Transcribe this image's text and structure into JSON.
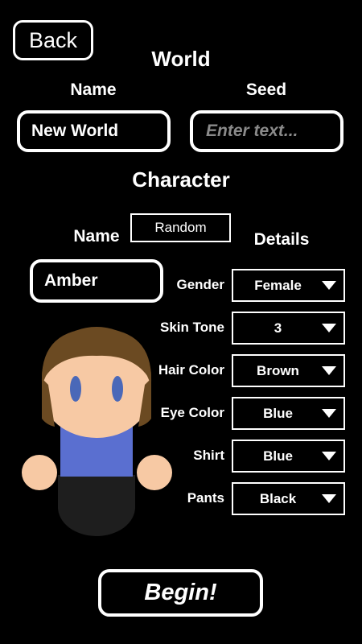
{
  "back_label": "Back",
  "world": {
    "heading": "World",
    "name_label": "Name",
    "seed_label": "Seed",
    "name_value": "New World",
    "seed_placeholder": "Enter text..."
  },
  "character": {
    "heading": "Character",
    "name_label": "Name",
    "random_label": "Random",
    "name_value": "Amber",
    "details_label": "Details",
    "details": [
      {
        "label": "Gender",
        "value": "Female"
      },
      {
        "label": "Skin Tone",
        "value": "3"
      },
      {
        "label": "Hair Color",
        "value": "Brown"
      },
      {
        "label": "Eye Color",
        "value": "Blue"
      },
      {
        "label": "Shirt",
        "value": "Blue"
      },
      {
        "label": "Pants",
        "value": "Black"
      }
    ],
    "avatar_colors": {
      "skin": "#f7c9a4",
      "hair": "#6b4a22",
      "eyes": "#4a68b8",
      "shirt": "#5a6fd0",
      "pants": "#1e1e1e"
    }
  },
  "begin_label": "Begin!"
}
